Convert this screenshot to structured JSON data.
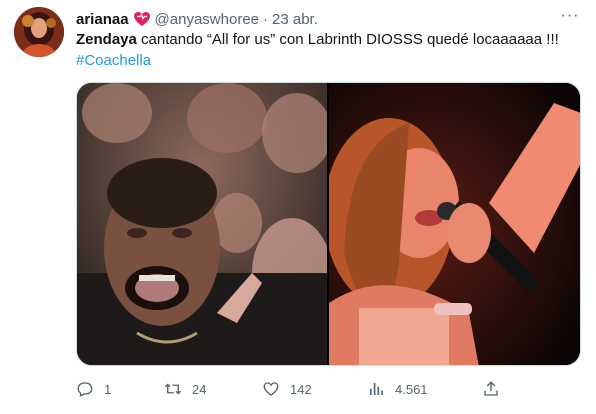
{
  "tweet": {
    "display_name": "arianaa",
    "handle": "@anyaswhoree",
    "separator": "·",
    "date": "23 abr.",
    "more_label": "···",
    "text_bold": "Zendaya",
    "text_rest": " cantando “All for us” con Labrinth DIOSSS quedé locaaaaaa !!!",
    "hashtag": "#Coachella",
    "heart_color": "#e0245e"
  },
  "actions": {
    "reply_count": "1",
    "retweet_count": "24",
    "like_count": "142",
    "views_count": "4.561"
  },
  "icons": [
    "heart-emoji-icon",
    "more-icon",
    "reply-icon",
    "retweet-icon",
    "like-icon",
    "views-icon",
    "share-icon"
  ],
  "colors": {
    "link": "#1d9bf0",
    "secondary_text": "#536471"
  }
}
